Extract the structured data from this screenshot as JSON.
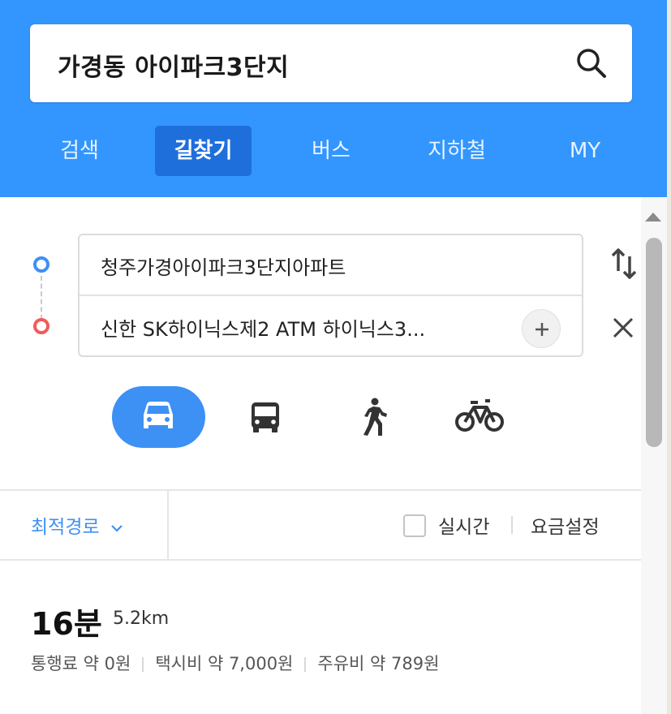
{
  "search": {
    "query": "가경동 아이파크3단지"
  },
  "tabs": [
    {
      "label": "검색"
    },
    {
      "label": "길찾기"
    },
    {
      "label": "버스"
    },
    {
      "label": "지하철"
    },
    {
      "label": "MY"
    }
  ],
  "active_tab": "길찾기",
  "route": {
    "origin": "청주가경아이파크3단지아파트",
    "destination": "신한 SK하이닉스제2 ATM 하이닉스3..."
  },
  "modes": [
    {
      "icon": "car-icon",
      "active": true
    },
    {
      "icon": "bus-icon",
      "active": false
    },
    {
      "icon": "walk-icon",
      "active": false
    },
    {
      "icon": "bicycle-icon",
      "active": false
    }
  ],
  "options": {
    "route_type": "최적경로",
    "realtime_label": "실시간",
    "realtime_checked": false,
    "fee_setting": "요금설정"
  },
  "result": {
    "time": "16분",
    "distance": "5.2km",
    "toll": "통행료 약 0원",
    "taxi": "택시비 약 7,000원",
    "fuel": "주유비 약 789원"
  },
  "colors": {
    "header": "#3396ff",
    "active_tab": "#1e6fdc",
    "accent": "#3d90f4",
    "origin_dot": "#3f8ff5",
    "destination_dot": "#f25a5a"
  }
}
